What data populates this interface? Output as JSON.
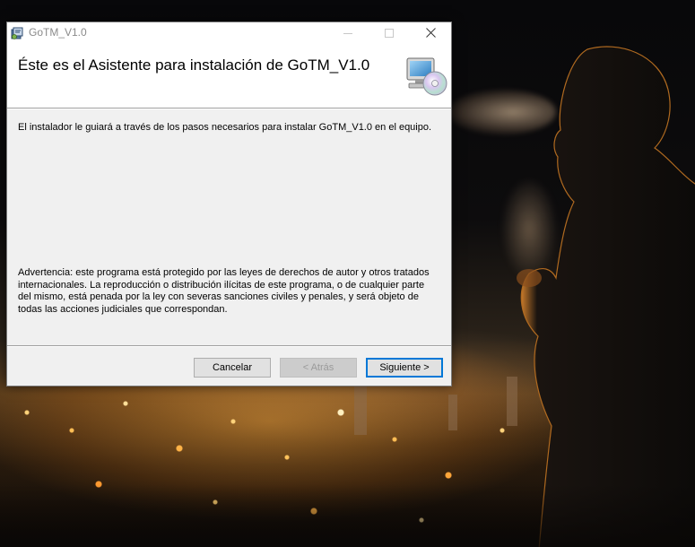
{
  "window": {
    "title": "GoTM_V1.0",
    "heading": "Éste es el Asistente para instalación de GoTM_V1.0",
    "body_text": "El instalador le guiará a través de los pasos necesarios para instalar GoTM_V1.0 en el equipo.",
    "warning_text": "Advertencia: este programa está protegido por las leyes de derechos de autor y otros tratados internacionales. La reproducción o distribución ilícitas de este programa, o de cualquier parte del mismo, está penada por la ley con severas sanciones civiles y penales, y será objeto de todas las acciones judiciales que correspondan.",
    "header_icon": "computer-cd-icon",
    "app_icon": "installer-package-icon"
  },
  "buttons": {
    "cancel": "Cancelar",
    "back": "< Atrás",
    "next": "Siguiente >"
  },
  "titlebar_controls": [
    "minimize-icon",
    "maximize-icon",
    "close-icon"
  ],
  "colors": {
    "accent": "#0078d7",
    "window_bg": "#f0f0f0",
    "header_bg": "#ffffff"
  }
}
